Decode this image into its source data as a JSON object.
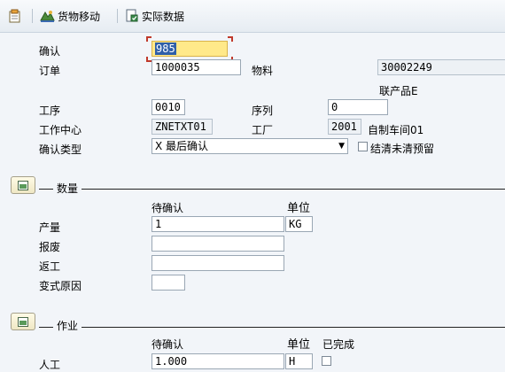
{
  "toolbar": {
    "goods_movement_label": "货物移动",
    "actual_data_label": "实际数据"
  },
  "header": {
    "confirm_label": "确认",
    "confirm_value": "985",
    "order_label": "订单",
    "order_value": "1000035",
    "material_label": "物料",
    "material_value": "30002249",
    "coproduct_text": "联产品E",
    "operation_label": "工序",
    "operation_value": "0010",
    "sequence_label": "序列",
    "sequence_value": "0",
    "work_center_label": "工作中心",
    "work_center_value": "ZNETXT01",
    "plant_label": "工厂",
    "plant_value": "2001",
    "plant_desc": "自制车间01",
    "confirm_type_label": "确认类型",
    "confirm_type_value": "X 最后确认",
    "clear_reservation_label": "结清未清预留"
  },
  "quantity_section": {
    "title": "数量",
    "col_to_confirm": "待确认",
    "col_unit": "单位",
    "yield_label": "产量",
    "yield_value": "1",
    "yield_unit": "KG",
    "scrap_label": "报废",
    "rework_label": "返工",
    "variance_reason_label": "变式原因"
  },
  "activity_section": {
    "title": "作业",
    "col_to_confirm": "待确认",
    "col_unit": "单位",
    "col_completed": "已完成",
    "labor_label": "人工",
    "labor_value": "1.000",
    "labor_unit": "H"
  },
  "colors": {
    "background": "#f2f5f9",
    "active_field": "#ffe98a",
    "focus_marker": "#c0392b"
  }
}
